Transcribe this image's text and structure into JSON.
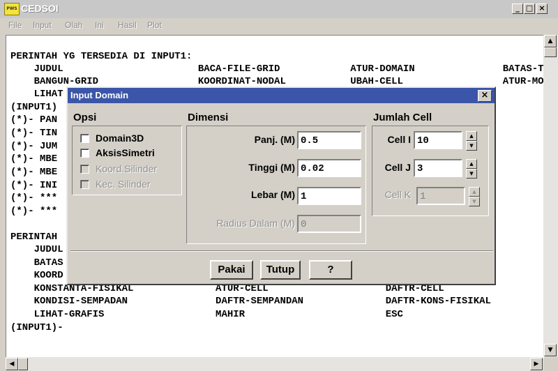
{
  "window": {
    "title": "CEDSOI",
    "icon_label": "PWS",
    "controls": {
      "minimize": "_",
      "maximize": "□",
      "close": "×"
    }
  },
  "menu": [
    "File",
    "Input",
    "Olah",
    "Ini",
    "Hasil",
    "Plot"
  ],
  "console": {
    "lines": [
      "PERINTAH YG TERSEDIA DI INPUT1:",
      "    JUDUL                       BACA-FILE-GRID            ATUR-DOMAIN               BATAS-TAYANGAN",
      "    BANGUN-GRID                 KOORDINAT-NODAL           UBAH-CELL                 ATUR-MODEL",
      "    LIHAT",
      "(INPUT1)",
      "(*)- PAN",
      "(*)- TIN",
      "(*)- JUM",
      "(*)- MBE",
      "(*)- MBE",
      "(*)- INI",
      "(*)- ***",
      "(*)- ***",
      "",
      "PERINTAH",
      "    JUDUL",
      "    BATAS",
      "    KOORD",
      "    KONSTANTA-FISIKAL              ATUR-CELL                    DAFTR-CELL",
      "    KONDISI-SEMPADAN               DAFTR-SEMPANDAN              DAFTR-KONS-FISIKAL",
      "    LIHAT-GRAFIS                   MAHIR                        ESC",
      "(INPUT1)-"
    ]
  },
  "dialog": {
    "title": "Input Domain",
    "close": "×",
    "opsi": {
      "label": "Opsi",
      "items": [
        {
          "label": "Domain3D",
          "enabled": true,
          "checked": false
        },
        {
          "label": "AksisSimetri",
          "enabled": true,
          "checked": false
        },
        {
          "label": "Koord.Silinder",
          "enabled": false,
          "checked": false
        },
        {
          "label": "Kec. Silinder",
          "enabled": false,
          "checked": false
        }
      ]
    },
    "dimensi": {
      "label": "Dimensi",
      "fields": [
        {
          "label": "Panj. (M)",
          "value": "0.5",
          "enabled": true
        },
        {
          "label": "Tinggi (M)",
          "value": "0.02",
          "enabled": true
        },
        {
          "label": "Lebar (M)",
          "value": "1",
          "enabled": true
        },
        {
          "label": "Radius Dalam (M)",
          "value": "0",
          "enabled": false
        }
      ]
    },
    "jumlah_cell": {
      "label": "Jumlah Cell",
      "fields": [
        {
          "label": "Cell I",
          "value": "10",
          "enabled": true
        },
        {
          "label": "Cell J",
          "value": "3",
          "enabled": true
        },
        {
          "label": "Cell K",
          "value": "1",
          "enabled": false
        }
      ]
    },
    "buttons": {
      "pakai": "Pakai",
      "tutup": "Tutup",
      "help": "?"
    }
  }
}
